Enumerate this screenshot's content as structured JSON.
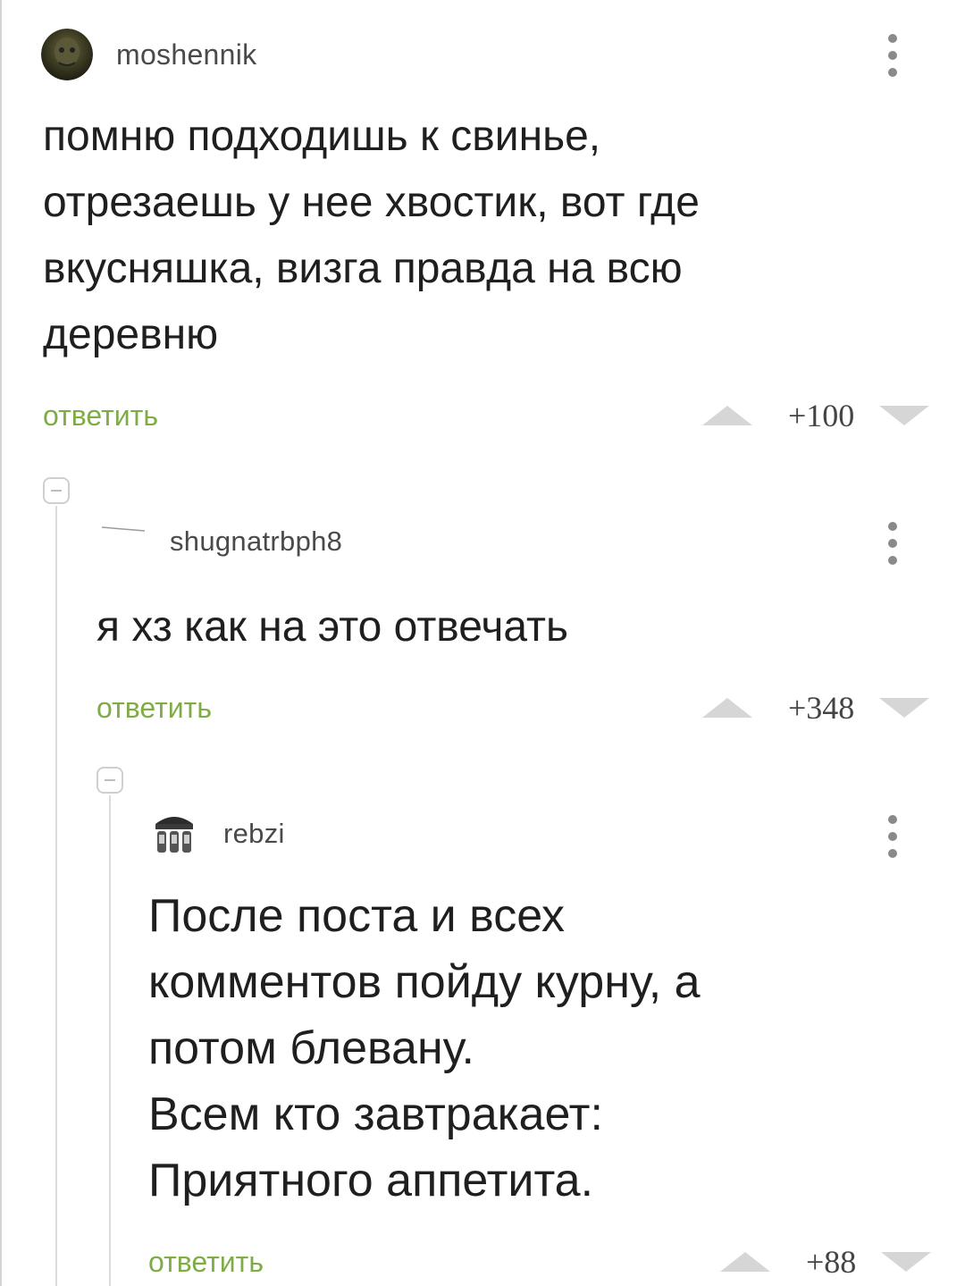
{
  "comments": [
    {
      "username": "moshennik",
      "text": "помню подходишь к свинье,\nотрезаешь у нее хвостик, вот где\nвкусняшка, визга правда на всю\nдеревню",
      "reply_label": "ответить",
      "score": "+100"
    },
    {
      "username": "shugnatrbph8",
      "text": "я хз как на это отвечать",
      "reply_label": "ответить",
      "score": "+348"
    },
    {
      "username": "rebzi",
      "text": "После поста и всех\nкомментов пойду курну, а\nпотом блевану.\nВсем кто завтракает:\nПриятного аппетита.",
      "reply_label": "ответить",
      "score": "+88"
    }
  ],
  "colors": {
    "accent_green": "#7fac46",
    "vote_arrow": "#d6d6d6",
    "thread_line": "#dcdcdc"
  },
  "icons": {
    "more": "more-vertical-icon",
    "vote_up": "arrow-up-icon",
    "vote_down": "arrow-down-icon",
    "collapse": "collapse-thread-icon"
  }
}
